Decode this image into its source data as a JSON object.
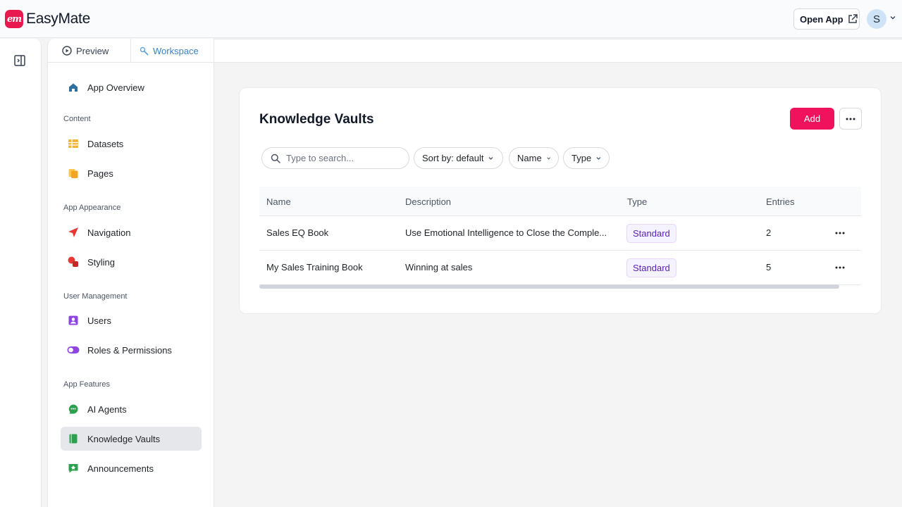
{
  "app": {
    "logo_mark": "em",
    "name": "EasyMate",
    "brand_color": "#e8194f"
  },
  "header": {
    "open_app_label": "Open App",
    "open_app_icon": "external-link-icon",
    "avatar_initial": "S"
  },
  "tabs": {
    "preview": "Preview",
    "workspace": "Workspace"
  },
  "sidebar": {
    "overview": {
      "label": "App Overview",
      "icon": "home-icon"
    },
    "sections": [
      {
        "label": "Content",
        "items": [
          {
            "label": "Datasets",
            "icon": "table-icon"
          },
          {
            "label": "Pages",
            "icon": "pages-icon"
          }
        ]
      },
      {
        "label": "App Appearance",
        "items": [
          {
            "label": "Navigation",
            "icon": "navigation-arrow-icon"
          },
          {
            "label": "Styling",
            "icon": "shapes-icon"
          }
        ]
      },
      {
        "label": "User Management",
        "items": [
          {
            "label": "Users",
            "icon": "user-icon"
          },
          {
            "label": "Roles & Permissions",
            "icon": "toggle-icon"
          }
        ]
      },
      {
        "label": "App Features",
        "items": [
          {
            "label": "AI Agents",
            "icon": "ai-agent-icon"
          },
          {
            "label": "Knowledge Vaults",
            "icon": "book-icon",
            "active": true
          },
          {
            "label": "Announcements",
            "icon": "announcement-icon"
          }
        ]
      }
    ]
  },
  "main": {
    "title": "Knowledge Vaults",
    "add_label": "Add",
    "search_placeholder": "Type to search...",
    "filters": {
      "sort": "Sort by: default",
      "name": "Name",
      "type": "Type"
    },
    "table": {
      "columns": [
        "Name",
        "Description",
        "Type",
        "Entries"
      ],
      "rows": [
        {
          "name": "Sales EQ Book",
          "description": "Use Emotional Intelligence to Close the Comple...",
          "type": "Standard",
          "entries": "2"
        },
        {
          "name": "My Sales Training Book",
          "description": "Winning at sales",
          "type": "Standard",
          "entries": "5"
        }
      ]
    },
    "accent_color": "#f0125c"
  }
}
